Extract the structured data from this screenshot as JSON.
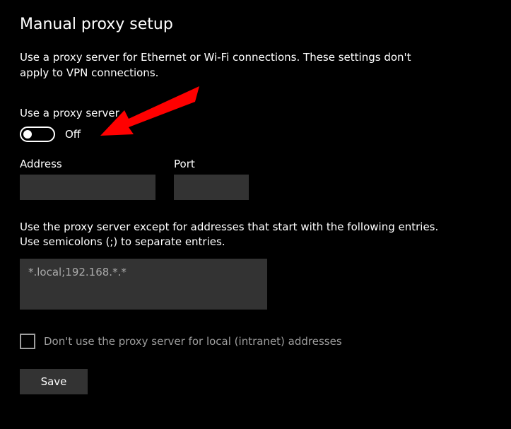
{
  "title": "Manual proxy setup",
  "description": "Use a proxy server for Ethernet or Wi-Fi connections. These settings don't apply to VPN connections.",
  "toggle": {
    "label": "Use a proxy server",
    "state": "Off"
  },
  "address": {
    "label": "Address",
    "value": ""
  },
  "port": {
    "label": "Port",
    "value": ""
  },
  "exceptions": {
    "label": "Use the proxy server except for addresses that start with the following entries. Use semicolons (;) to separate entries.",
    "value": "*.local;192.168.*.*"
  },
  "bypass_local": {
    "label": "Don't use the proxy server for local (intranet) addresses",
    "checked": false
  },
  "save_label": "Save"
}
